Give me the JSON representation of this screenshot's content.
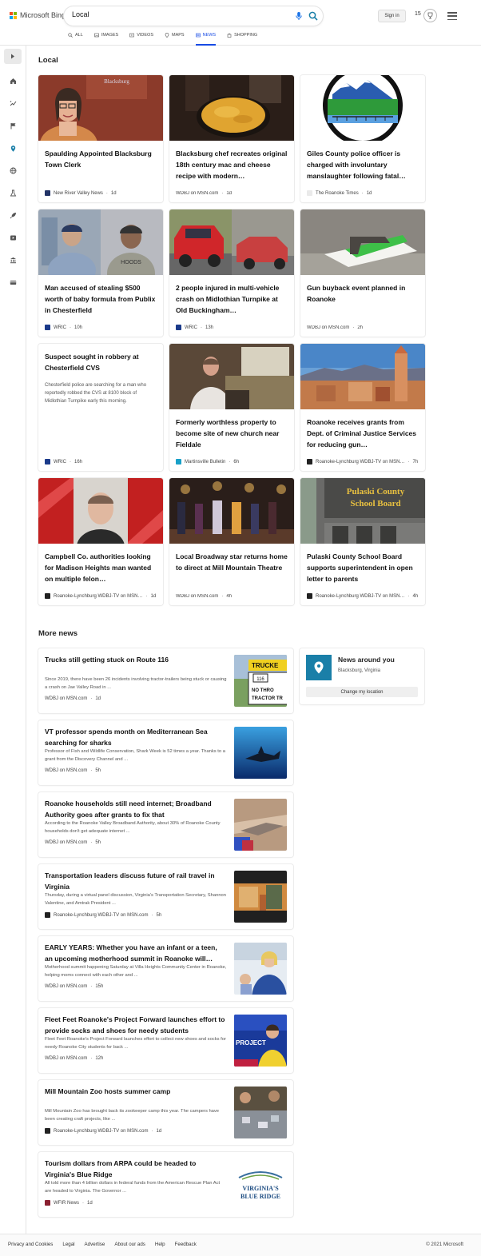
{
  "header": {
    "logo_text": "Microsoft Bing",
    "search_value": "Local",
    "signin_label": "Sign in",
    "points": "15"
  },
  "tabs": [
    {
      "label": "All"
    },
    {
      "label": "Images"
    },
    {
      "label": "Videos"
    },
    {
      "label": "Maps"
    },
    {
      "label": "News"
    },
    {
      "label": "Shopping"
    }
  ],
  "local": {
    "title": "Local",
    "cards": [
      {
        "title": "Spaulding Appointed Blacksburg Town Clerk",
        "source": "New River Valley News",
        "time": "1d"
      },
      {
        "title": "Blacksburg chef recreates original 18th century mac and cheese recipe with modern…",
        "source": "WDBJ on MSN.com",
        "time": "1d"
      },
      {
        "title": "Giles County police officer is charged with involuntary manslaughter following fatal…",
        "source": "The Roanoke Times",
        "time": "1d"
      },
      {
        "title": "Man accused of stealing $500 worth of baby formula from Publix in Chesterfield",
        "source": "WRIC",
        "time": "10h"
      },
      {
        "title": "2 people injured in multi-vehicle crash on Midlothian Turnpike at Old Buckingham…",
        "source": "WRIC",
        "time": "13h"
      },
      {
        "title": "Gun buyback event planned in Roanoke",
        "source": "WDBJ on MSN.com",
        "time": "2h"
      },
      {
        "title": "Suspect sought in robbery at Chesterfield CVS",
        "desc": "Chesterfield police are searching for a man who reportedly robbed the CVS at 8100 block of Midlothian Turnpike early this morning.",
        "source": "WRIC",
        "time": "16h"
      },
      {
        "title": "Formerly worthless property to become site of new church near Fieldale",
        "source": "Martinsville Bulletin",
        "time": "6h"
      },
      {
        "title": "Roanoke receives grants from Dept. of Criminal Justice Services for reducing gun…",
        "source": "Roanoke-Lynchburg WDBJ-TV on MSN…",
        "time": "7h"
      },
      {
        "title": "Campbell Co. authorities looking for Madison Heights man wanted on multiple felon…",
        "source": "Roanoke-Lynchburg WDBJ-TV on MSN…",
        "time": "1d"
      },
      {
        "title": "Local Broadway star returns home to direct at Mill Mountain Theatre",
        "source": "WDBJ on MSN.com",
        "time": "4h"
      },
      {
        "title": "Pulaski County School Board supports superintendent in open letter to parents",
        "source": "Roanoke-Lynchburg WDBJ-TV on MSN…",
        "time": "4h"
      }
    ],
    "image_texts": {
      "blacksburg_sign": "Blacksburg",
      "school_board_sign_1": "Pulaski County",
      "school_board_sign_2": "School Board",
      "truck_sign_1": "TRUCKE",
      "truck_sign_2": "116",
      "truck_sign_3": "NO THRO",
      "truck_sign_4": "TRACTOR TR",
      "project_sign": "PROJECT",
      "vbr_1": "VIRGINIA'S",
      "vbr_2": "BLUE RIDGE",
      "hoods_shirt": "HOODS"
    }
  },
  "more_news": {
    "title": "More news",
    "items": [
      {
        "title": "Trucks still getting stuck on Route 116",
        "desc": "Since 2019, there have been 26 incidents involving tractor-trailers being stuck or causing a crash on Jae Valley Road in ...",
        "source": "WDBJ on MSN.com",
        "time": "1d"
      },
      {
        "title": "VT professor spends month on Mediterranean Sea searching for sharks",
        "desc": "Professor of Fish and Wildlife Conservation, Shark Week is 52 times a year. Thanks to a grant from the Discovery Channel and ...",
        "source": "WDBJ on MSN.com",
        "time": "5h"
      },
      {
        "title": "Roanoke households still need internet; Broadband Authority goes after grants to fix that",
        "desc": "According to the Roanoke Valley Broadband Authority, about 30% of Roanoke County households don't get adequate internet ...",
        "source": "WDBJ on MSN.com",
        "time": "5h"
      },
      {
        "title": "Transportation leaders discuss future of rail travel in Virginia",
        "desc": "Thursday, during a virtual panel discussion, Virginia's Transportation Secretary, Shannon Valentine, and Amtrak President ...",
        "source": "Roanoke-Lynchburg WDBJ-TV on MSN.com",
        "time": "5h"
      },
      {
        "title": "EARLY YEARS: Whether you have an infant or a teen, an upcoming motherhood summit in Roanoke will…",
        "desc": "Motherhood summit happening Saturday at Villa Heights Community Center in Roanoke, helping moms connect with each other and ...",
        "source": "WDBJ on MSN.com",
        "time": "15h"
      },
      {
        "title": "Fleet Feet Roanoke's Project Forward launches effort to provide socks and shoes for needy students",
        "desc": "Fleet Feet Roanoke's Project Forward launches effort to collect new shoes and socks for needy Roanoke City students for back ...",
        "source": "WDBJ on MSN.com",
        "time": "12h"
      },
      {
        "title": "Mill Mountain Zoo hosts summer camp",
        "desc": "Mill Mountain Zoo has brought back its zookeeper camp this year. The campers have been creating craft projects, like ...",
        "source": "Roanoke-Lynchburg WDBJ-TV on MSN.com",
        "time": "1d"
      },
      {
        "title": "Tourism dollars from ARPA could be headed to Virginia's Blue Ridge",
        "desc": "All told more than 4 billion dollars in federal funds from the American Rescue Plan Act are headed to Virginia. The Governor ...",
        "source": "WFIR News",
        "time": "1d"
      }
    ]
  },
  "location": {
    "title": "News around you",
    "place": "Blacksburg, Virginia",
    "button": "Change my location"
  },
  "footer": {
    "links": [
      "Privacy and Cookies",
      "Legal",
      "Advertise",
      "About our ads",
      "Help",
      "Feedback"
    ],
    "copyright": "© 2021 Microsoft"
  },
  "colors": {
    "accent": "#174ae4",
    "location_tile": "#1a7fa8"
  }
}
